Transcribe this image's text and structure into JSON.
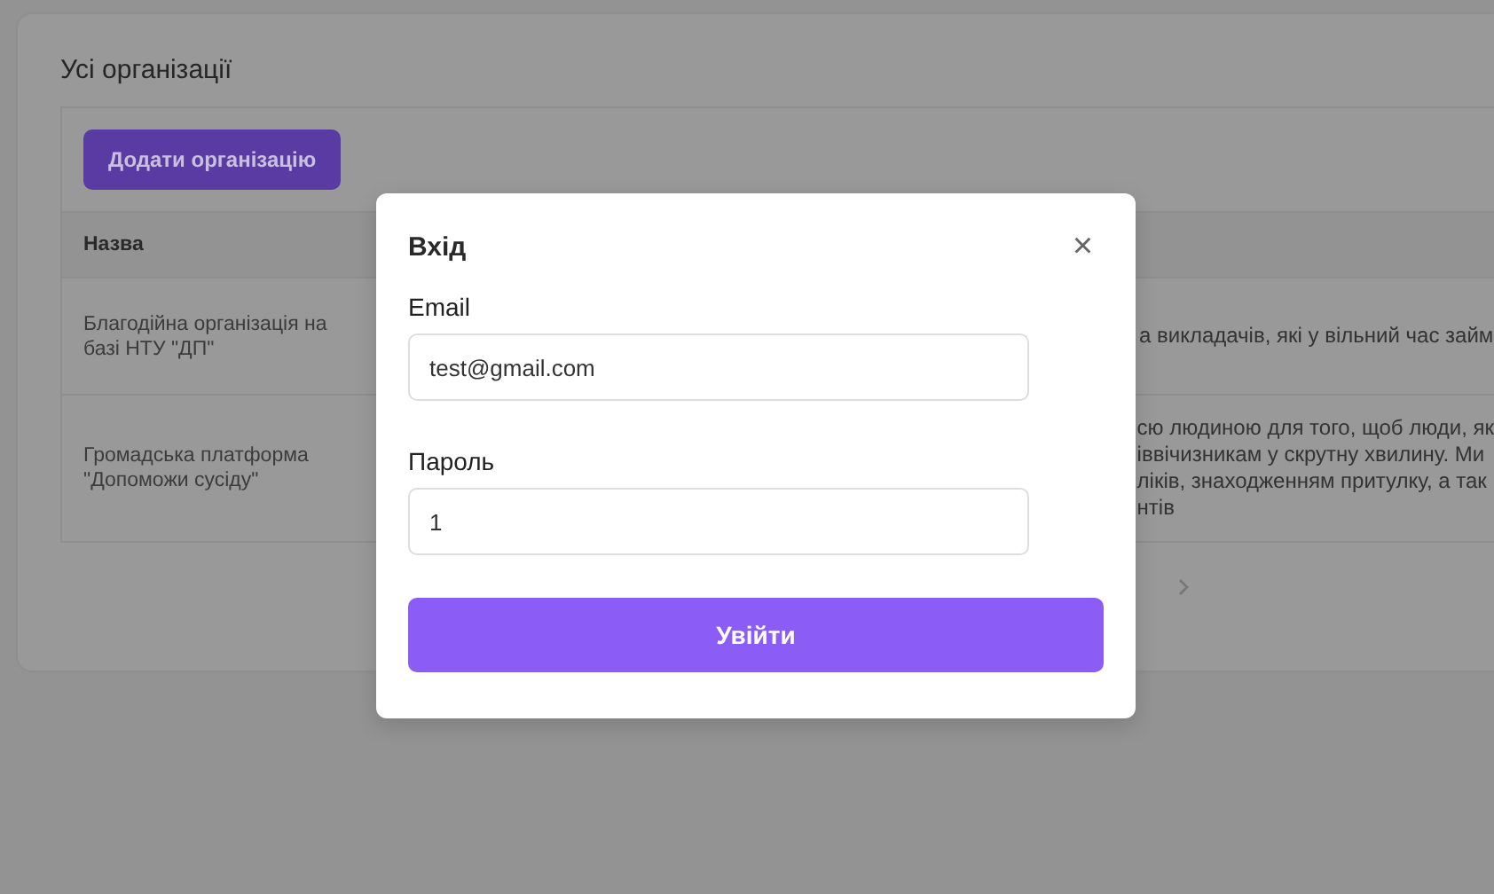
{
  "page": {
    "title": "Усі організації",
    "add_button": "Додати організацію"
  },
  "table": {
    "columns": [
      "Назва"
    ],
    "rows": [
      {
        "name": "Благодійна організація на базі НТУ \"ДП\"",
        "column_2": [
          "а викладачів, які у вільний час займ"
        ]
      },
      {
        "name": "Громадська платформа \"Допоможи сусіду\"",
        "column_2": [
          "сю людиною для того, щоб люди, як",
          "іввічизникам у скрутну хвилину. Ми",
          "ліків, знаходженням притулку, а так",
          "нтів"
        ]
      }
    ]
  },
  "modal": {
    "title": "Вхід",
    "close": "×",
    "fields": [
      {
        "label": "Email",
        "value": "test@gmail.com"
      },
      {
        "label": "Пароль",
        "value": "1"
      }
    ],
    "submit": "Увійти"
  }
}
